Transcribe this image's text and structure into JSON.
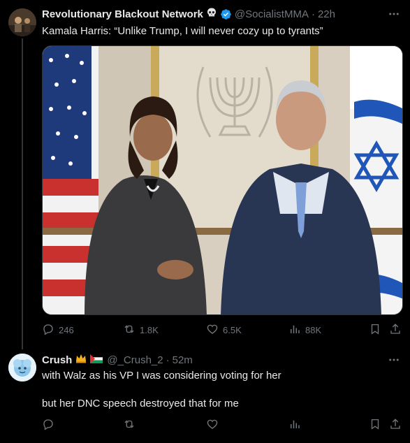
{
  "colors": {
    "background": "#000000",
    "text_primary": "#e7e9ea",
    "text_secondary": "#71767b",
    "verified_blue": "#1d9bf0",
    "divider": "#333639"
  },
  "tweet1": {
    "display_name": "Revolutionary Blackout Network",
    "handle": "@SocialistMMA",
    "time": "22h",
    "text": "Kamala Harris: “Unlike Trump, I will never cozy up to tyrants”",
    "stats": {
      "replies": "246",
      "reposts": "1.8K",
      "likes": "6.5K",
      "views": "88K"
    },
    "icons": [
      "reply-icon",
      "repost-icon",
      "like-icon",
      "views-icon",
      "bookmark-icon",
      "share-icon",
      "more-icon",
      "verified-badge-icon",
      "skull-emoji-icon"
    ]
  },
  "tweet2": {
    "display_name": "Crush",
    "handle": "@_Crush_2",
    "time": "52m",
    "text_line1": "with Walz as his VP I was considering voting for her",
    "text_line2": "but her DNC speech destroyed that for me",
    "icons": [
      "reply-icon",
      "repost-icon",
      "like-icon",
      "views-icon",
      "bookmark-icon",
      "share-icon",
      "more-icon",
      "crown-emoji-icon",
      "palestine-flag-icon"
    ]
  },
  "shared": {
    "dot": "·"
  }
}
